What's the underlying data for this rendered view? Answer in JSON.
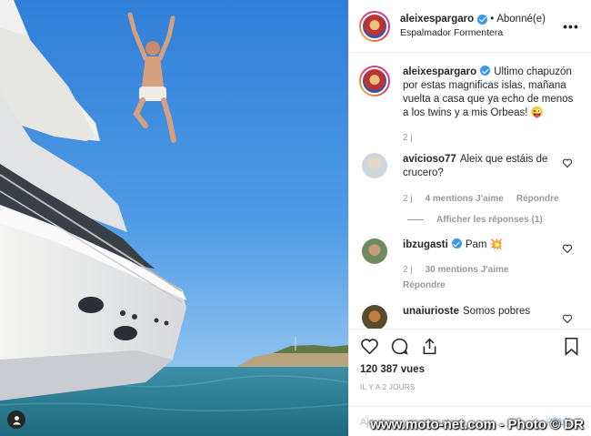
{
  "post": {
    "author": "aleixespargaro",
    "follow_status": "Abonné(e)",
    "separator": "•",
    "location": "Espalmador Formentera",
    "caption": "Ultimo chapuzón por estas magnificas islas, mañana vuelta a casa que ya echo de menos a los twins y a mis Orbeas! 😜",
    "caption_time": "2 j",
    "more_icon": "ellipsis-icon"
  },
  "comments": [
    {
      "user": "avicioso77",
      "text": "Aleix que estáis de crucero?",
      "time": "2 j",
      "likes": "4 mentions J'aime",
      "reply": "Répondre",
      "replies_link": "Afficher les réponses (1)"
    },
    {
      "user": "ibzugasti",
      "text": "Pam 💥",
      "time": "2 j",
      "likes": "30 mentions J'aime",
      "reply": "Répondre",
      "verified": true
    },
    {
      "user": "unaiurioste",
      "text": "Somos pobres"
    }
  ],
  "actions": {
    "views": "120 387 vues",
    "timestamp": "IL Y A 2 JOURS",
    "add_comment_placeholder": "Ajouter un commentaire…",
    "publish": "Publier"
  },
  "watermark": "www.moto-net.com - Photo © DR",
  "colors": {
    "verified": "#3897f0",
    "muted": "#999999",
    "border": "#efefef",
    "sky": "#3e8fe0",
    "sea": "#2b7b94"
  }
}
